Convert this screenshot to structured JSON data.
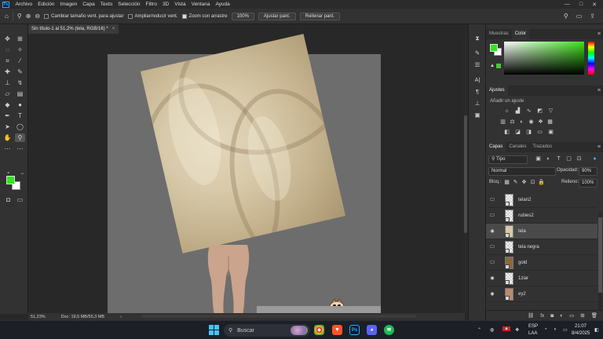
{
  "menubar": {
    "logo": "Ps",
    "items": [
      "Archivo",
      "Edición",
      "Imagen",
      "Capa",
      "Texto",
      "Selección",
      "Filtro",
      "3D",
      "Vista",
      "Ventana",
      "Ayuda"
    ],
    "controls": [
      "—",
      "□",
      "✕"
    ]
  },
  "options_bar": {
    "checkbox_1": {
      "label": "Cambiar tamaño vent. para ajustar",
      "checked": false
    },
    "checkbox_2": {
      "label": "Ampliar/reducir vent.",
      "checked": false
    },
    "checkbox_3": {
      "label": "Zoom con arrastre",
      "checked": true
    },
    "zoom_value": "100%",
    "fit_button": "Ajustar pant.",
    "fill_button": "Rellenar pant."
  },
  "document": {
    "tab_title": "Sin título-1 al 51,2% (tela, RGB/16) *",
    "close": "×"
  },
  "status": {
    "zoom": "51,23%",
    "doc_size": "Doc: 19,5 MB/55,3 MB"
  },
  "colors": {
    "foreground": "#2ae81d",
    "background": "#ffffff",
    "accent": "#31a8ff"
  },
  "color_panel": {
    "tabs": [
      "Muestras",
      "Color"
    ],
    "active_tab": "Color"
  },
  "adjustments_panel": {
    "tab": "Ajustes",
    "hint": "Añadir un ajuste"
  },
  "layers_panel": {
    "tabs": [
      "Capas",
      "Canales",
      "Trazados"
    ],
    "active_tab": "Capas",
    "filter_kind": "Tipo",
    "blend_mode": "Normal",
    "opacity_label": "Opacidad:",
    "opacity_value": "90%",
    "lock_label": "Bloq.:",
    "fill_label": "Relleno:",
    "fill_value": "100%",
    "layers": [
      {
        "name": "telan2",
        "visible": false,
        "selected": false
      },
      {
        "name": "rubies2",
        "visible": false,
        "selected": false
      },
      {
        "name": "tela",
        "visible": true,
        "selected": true
      },
      {
        "name": "tela negra",
        "visible": false,
        "selected": false
      },
      {
        "name": "gold",
        "visible": false,
        "selected": false
      },
      {
        "name": "1ziar",
        "visible": true,
        "selected": false
      },
      {
        "name": "ey2",
        "visible": true,
        "selected": false
      }
    ]
  },
  "taskbar": {
    "search_placeholder": "Buscar",
    "language": "ESP",
    "language_sub": "LAA",
    "time": "21:07",
    "date": "8/4/2025"
  }
}
